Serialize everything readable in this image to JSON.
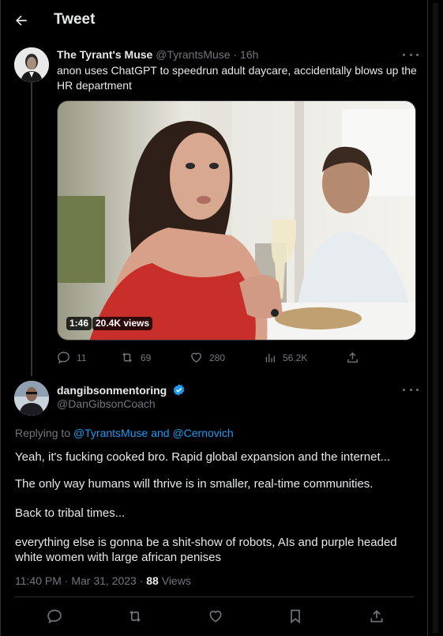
{
  "header": {
    "title": "Tweet",
    "back_icon": "arrow-left-icon"
  },
  "tweet1": {
    "author_name": "The Tyrant's Muse",
    "author_handle": "@TyrantsMuse",
    "time": "16h",
    "separator": "·",
    "text": "anon uses ChatGPT to speedrun adult daycare, accidentally blows up the HR department",
    "media": {
      "duration": "1:46",
      "views": "20.4K views"
    },
    "actions": {
      "replies": "11",
      "retweets": "69",
      "likes": "280",
      "views": "56.2K"
    }
  },
  "tweet2": {
    "author_name": "dangibsonmentoring",
    "author_handle": "@DanGibsonCoach",
    "replying_label": "Replying to",
    "replying_to_1": "@TyrantsMuse",
    "replying_and": "and",
    "replying_to_2": "@Cernovich",
    "paragraphs": [
      "Yeah, it's fucking cooked bro. Rapid global expansion and the internet...",
      "The only way humans will thrive is in smaller, real-time communities.",
      "Back to tribal times...",
      "everything else is gonna be a shit-show of robots, AIs and purple headed white women with large african penises"
    ],
    "time": "11:40 PM · Mar 31, 2023 ·",
    "view_count": "88",
    "views_label": "Views"
  },
  "colors": {
    "accent": "#1d9bf0",
    "muted": "#71767b",
    "text": "#e7e9ea",
    "background": "#000000"
  }
}
